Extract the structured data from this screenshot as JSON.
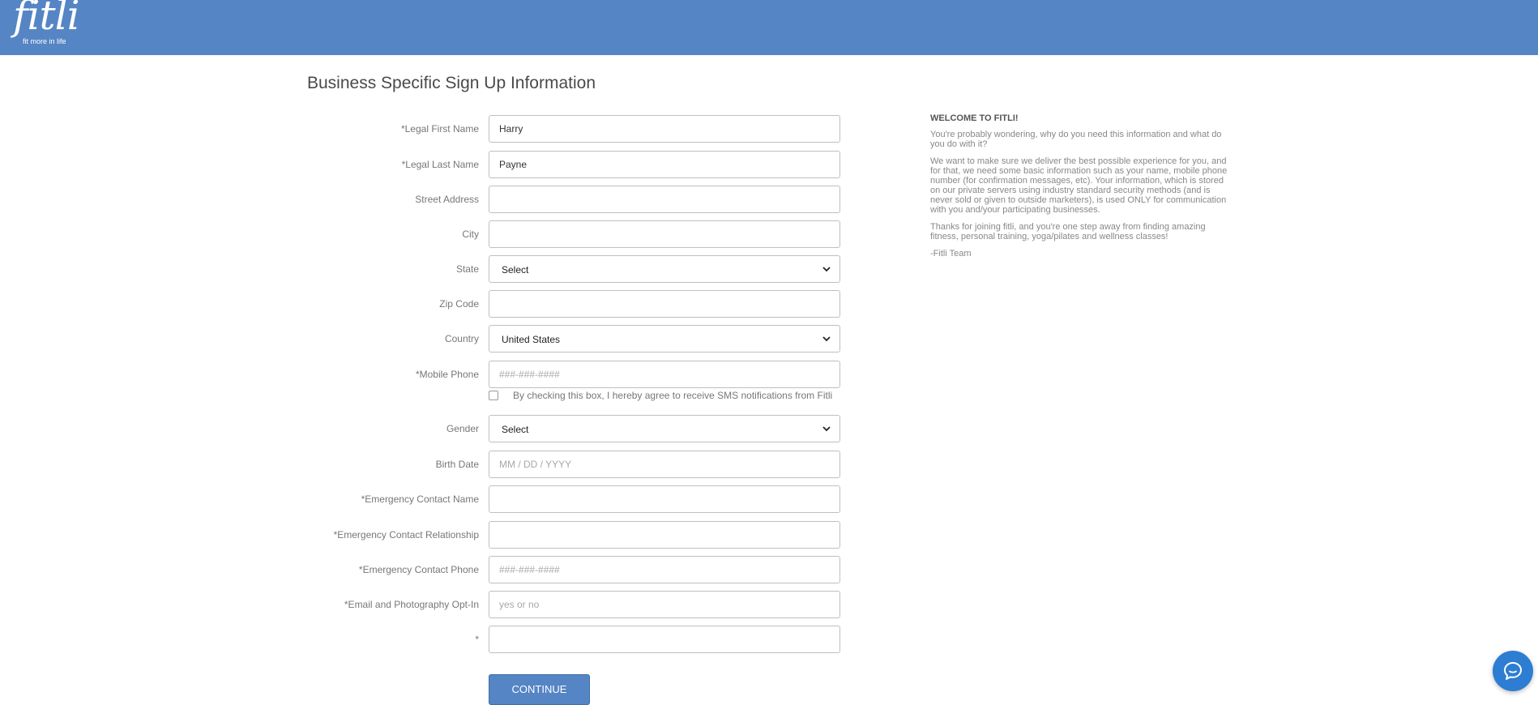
{
  "header": {
    "logo_word": "fitli",
    "logo_tagline": "fit more in life",
    "background_color": "#5585c4"
  },
  "page": {
    "title": "Business Specific Sign Up Information"
  },
  "form": {
    "first_name": {
      "label": "*Legal First Name",
      "value": "Harry",
      "placeholder": ""
    },
    "last_name": {
      "label": "*Legal Last Name",
      "value": "Payne",
      "placeholder": ""
    },
    "street": {
      "label": "Street Address",
      "value": "",
      "placeholder": ""
    },
    "city": {
      "label": "City",
      "value": "",
      "placeholder": ""
    },
    "state": {
      "label": "State",
      "selected": "Select"
    },
    "zip": {
      "label": "Zip Code",
      "value": "",
      "placeholder": ""
    },
    "country": {
      "label": "Country",
      "selected": "United States"
    },
    "mobile": {
      "label": "*Mobile Phone",
      "value": "",
      "placeholder": "###-###-####"
    },
    "sms_consent": {
      "label": "By checking this box, I hereby agree to receive SMS notifications from Fitli",
      "checked": false
    },
    "gender": {
      "label": "Gender",
      "selected": "Select"
    },
    "birth_date": {
      "label": "Birth Date",
      "value": "",
      "placeholder": "MM / DD / YYYY"
    },
    "emergency_name": {
      "label": "*Emergency Contact Name",
      "value": "",
      "placeholder": ""
    },
    "emergency_relationship": {
      "label": "*Emergency Contact Relationship",
      "value": "",
      "placeholder": ""
    },
    "emergency_phone": {
      "label": "*Emergency Contact Phone",
      "value": "",
      "placeholder": "###-###-####"
    },
    "photo_optin": {
      "label": "*Email and Photography Opt-In",
      "value": "",
      "placeholder": "yes or no"
    },
    "extra": {
      "label": "*",
      "value": "",
      "placeholder": ""
    },
    "continue_label": "CONTINUE"
  },
  "welcome": {
    "title": "WELCOME TO FITLI!",
    "p1": "You're probably wondering, why do you need this information and what do you do with it?",
    "p2": "We want to make sure we deliver the best possible experience for you, and for that, we need some basic information such as your name, mobile phone number (for confirmation messages, etc).  Your information, which is stored on our private servers using industry standard security methods (and is never sold or given to outside marketers), is used ONLY for communication with you and/your participating businesses.",
    "p3": "Thanks for joining fitli, and you're one step away from finding amazing fitness, personal training, yoga/pilates and wellness classes!",
    "signoff": "-Fitli Team"
  },
  "chat": {
    "icon": "chat-bubble-icon",
    "color": "#2d7dd2"
  }
}
